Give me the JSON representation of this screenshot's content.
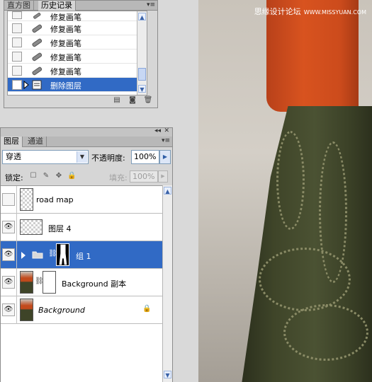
{
  "watermark": {
    "text": "思缘设计论坛",
    "url": "WWW.MISSYUAN.COM"
  },
  "history_panel": {
    "tabs": [
      "直方图",
      "历史记录"
    ],
    "menu_icon": "panel-menu-icon",
    "items": [
      {
        "label": "修复画笔",
        "icon": "bandaid-icon",
        "selected": false
      },
      {
        "label": "修复画笔",
        "icon": "bandaid-icon",
        "selected": false
      },
      {
        "label": "修复画笔",
        "icon": "bandaid-icon",
        "selected": false
      },
      {
        "label": "修复画笔",
        "icon": "bandaid-icon",
        "selected": false
      },
      {
        "label": "修复画笔",
        "icon": "bandaid-icon",
        "selected": false
      },
      {
        "label": "删除图层",
        "icon": "delete-layer-icon",
        "selected": true
      }
    ],
    "footer_icons": [
      "new-document-from-state-icon",
      "snapshot-camera-icon",
      "trash-icon"
    ]
  },
  "layers_panel": {
    "topbar_controls": [
      "collapse-icon",
      "close-icon"
    ],
    "tabs": [
      "图层",
      "通道"
    ],
    "blend_mode": "穿透",
    "opacity_label": "不透明度:",
    "opacity_value": "100%",
    "lock_label": "锁定:",
    "fill_label": "填充:",
    "fill_value": "100%",
    "layers": [
      {
        "name": "road map",
        "visible": false,
        "thumb": "transparent",
        "selected": false,
        "italic": false,
        "locked": false
      },
      {
        "name": "图层 4",
        "visible": true,
        "thumb": "transparent",
        "selected": false,
        "italic": false,
        "locked": false
      },
      {
        "name": "组 1",
        "visible": true,
        "thumb": "group",
        "selected": true,
        "italic": false,
        "locked": false,
        "has_mask": true
      },
      {
        "name": "Background 副本",
        "visible": true,
        "thumb": "photo",
        "selected": false,
        "italic": false,
        "locked": false,
        "has_mask": true
      },
      {
        "name": "Background",
        "visible": true,
        "thumb": "photo",
        "selected": false,
        "italic": true,
        "locked": true
      }
    ]
  },
  "colors": {
    "selection": "#316ac5",
    "panel": "#d6d6d6",
    "shirt": "#d8531f",
    "skirt": "#3f4529"
  }
}
